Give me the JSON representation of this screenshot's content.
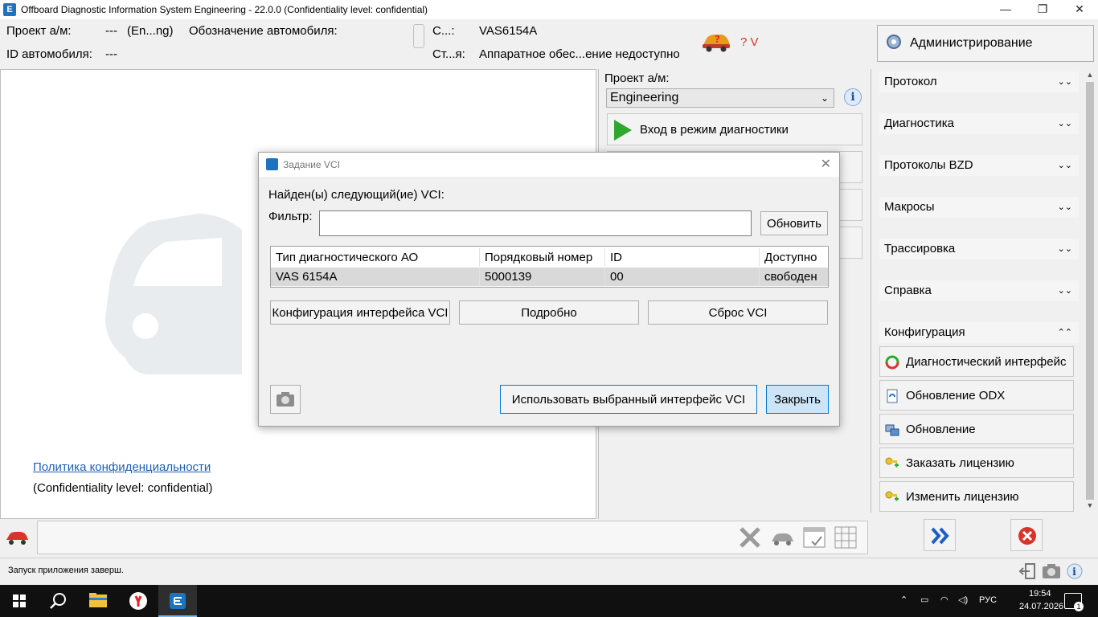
{
  "window": {
    "title": "Offboard Diagnostic Information System Engineering - 22.0.0 (Confidentiality level: confidential)",
    "minimize": "—",
    "maximize": "❐",
    "close": "✕"
  },
  "header": {
    "project_label": "Проект а/м:",
    "project_value1": "---",
    "project_value2": "(En...ng)",
    "vehicle_designation_label": "Обозначение автомобиля:",
    "vehicle_id_label": "ID автомобиля:",
    "vehicle_id_value": "---",
    "c_label": "С...:",
    "c_value": "VAS6154A",
    "st_label": "Ст...я:",
    "st_value": "Аппаратное обес...ение недоступно",
    "status_question": "? V"
  },
  "admin_button": "Администрирование",
  "main": {
    "privacy_link": "Политика конфиденциальности",
    "confidentiality": "(Confidentiality level: confidential)"
  },
  "mid": {
    "project_label": "Проект а/м:",
    "project_select": "Engineering",
    "diag_button": "Вход в режим диагностики"
  },
  "sidebar": {
    "sections": [
      {
        "label": "Протокол",
        "chev": "⌄⌄"
      },
      {
        "label": "Диагностика",
        "chev": "⌄⌄"
      },
      {
        "label": "Протоколы BZD",
        "chev": "⌄⌄"
      },
      {
        "label": "Макросы",
        "chev": "⌄⌄"
      },
      {
        "label": "Трассировка",
        "chev": "⌄⌄"
      },
      {
        "label": "Справка",
        "chev": "⌄⌄"
      },
      {
        "label": "Конфигурация",
        "chev": "⌃⌃"
      }
    ],
    "config_items": [
      {
        "label": "Диагностический интерфейс"
      },
      {
        "label": "Обновление ODX"
      },
      {
        "label": "Обновление"
      },
      {
        "label": "Заказать лицензию"
      },
      {
        "label": "Изменить лицензию"
      }
    ]
  },
  "status_bar": {
    "text": "Запуск приложения заверш."
  },
  "taskbar": {
    "lang": "РУС",
    "time": "19:54",
    "date": "24.07.2026",
    "notif_count": "1"
  },
  "dialog": {
    "title": "Задание VCI",
    "found_label": "Найден(ы) следующий(ие) VCI:",
    "filter_label": "Фильтр:",
    "filter_value": "",
    "refresh_button": "Обновить",
    "columns": [
      "Тип диагностического АО",
      "Порядковый номер",
      "ID",
      "Доступно"
    ],
    "rows": [
      [
        "VAS 6154A",
        "5000139",
        "00",
        "свободен"
      ]
    ],
    "config_button": "Конфигурация интерфейса VCI",
    "details_button": "Подробно",
    "reset_button": "Сброс VCI",
    "use_button": "Использовать выбранный интерфейс VCI",
    "close_button": "Закрыть"
  },
  "colors": {
    "accent": "#0078d7",
    "link": "#1e5fb4",
    "play_green": "#2fa82f",
    "error_red": "#d9342b",
    "taskbar": "#101010"
  }
}
